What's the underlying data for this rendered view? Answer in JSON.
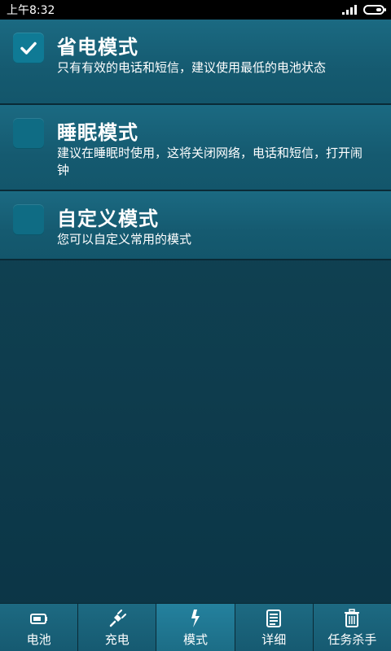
{
  "status_bar": {
    "time": "上午8:32"
  },
  "modes": [
    {
      "title": "省电模式",
      "description": "只有有效的电话和短信，建议使用最低的电池状态",
      "checked": true
    },
    {
      "title": "睡眠模式",
      "description": "建议在睡眠时使用，这将关闭网络，电话和短信，打开闹钟",
      "checked": false
    },
    {
      "title": "自定义模式",
      "description": "您可以自定义常用的模式",
      "checked": false
    }
  ],
  "bottom_nav": {
    "tabs": [
      {
        "label": "电池",
        "icon": "battery-icon"
      },
      {
        "label": "充电",
        "icon": "plug-icon"
      },
      {
        "label": "模式",
        "icon": "lightning-icon",
        "active": true
      },
      {
        "label": "详细",
        "icon": "document-icon"
      },
      {
        "label": "任务杀手",
        "icon": "trash-icon"
      }
    ]
  },
  "colors": {
    "background": "#0f3f50",
    "item_background": "#155a70",
    "checkbox": "#0f6c84",
    "active_tab": "#24819e"
  }
}
